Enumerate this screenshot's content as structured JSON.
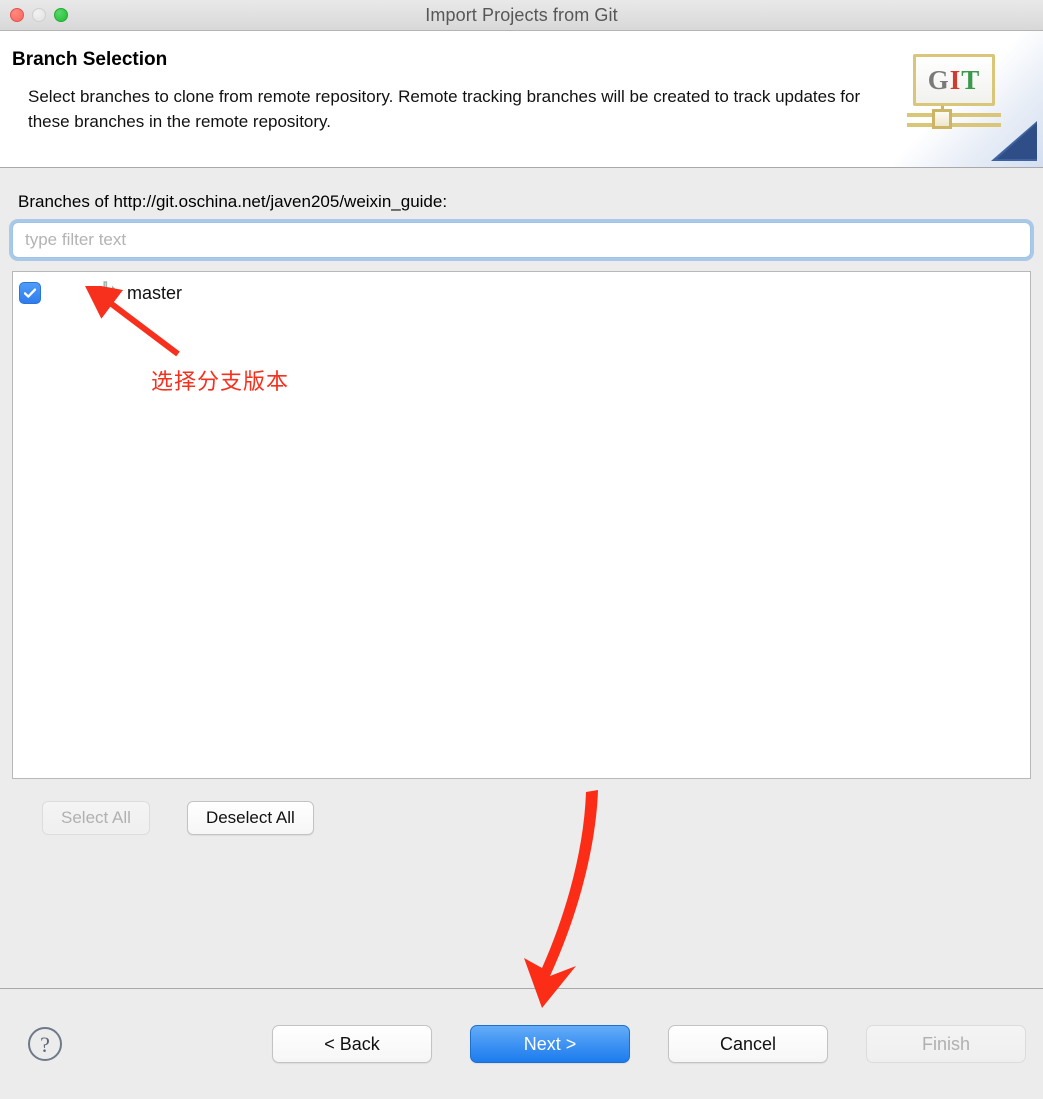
{
  "window": {
    "title": "Import Projects from Git",
    "traffic_lights": [
      "close-button",
      "minimize-button",
      "zoom-button"
    ]
  },
  "header": {
    "title": "Branch Selection",
    "description": "Select branches to clone from remote repository. Remote tracking branches will be created to track updates for these branches in the remote repository.",
    "banner_icon": "git-banner-icon",
    "banner_letters": {
      "g": "G",
      "i": "I",
      "t": "T"
    }
  },
  "main": {
    "branches_label": "Branches of http://git.oschina.net/javen205/weixin_guide:",
    "filter": {
      "placeholder": "type filter text",
      "value": ""
    },
    "branches": [
      {
        "name": "master",
        "checked": true,
        "icon": "git-branch-icon"
      }
    ],
    "annotation": {
      "text": "选择分支版本",
      "color": "#f7301d"
    },
    "select_all_label": "Select All",
    "select_all_disabled": true,
    "deselect_all_label": "Deselect All",
    "deselect_all_disabled": false
  },
  "footer": {
    "help_icon": "help-question-icon",
    "back_label": "< Back",
    "next_label": "Next >",
    "cancel_label": "Cancel",
    "finish_label": "Finish",
    "finish_disabled": true,
    "next_is_default": true
  },
  "colors": {
    "accent_blue": "#1c7ced",
    "annotation_red": "#f7301d",
    "window_bg": "#ececec",
    "checkbox_blue": "#2f7ced"
  }
}
